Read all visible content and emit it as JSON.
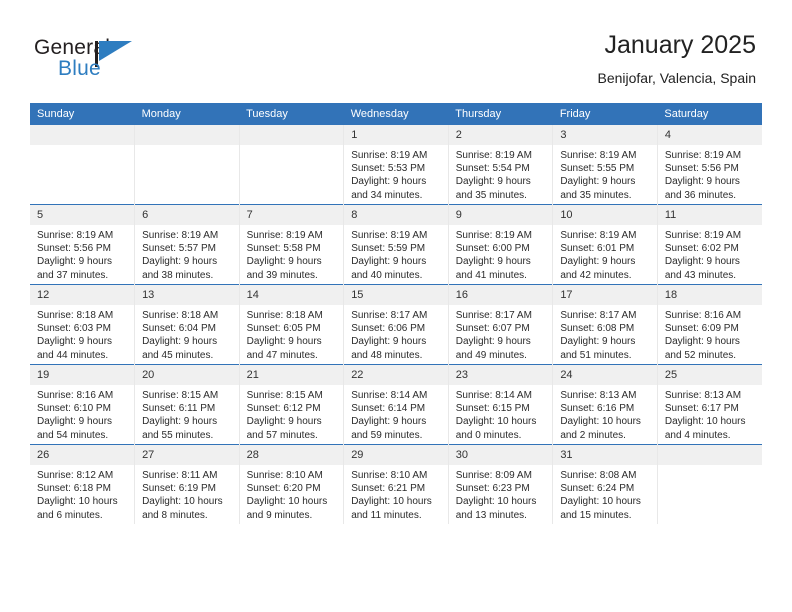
{
  "brand": {
    "name_top": "General",
    "name_bottom": "Blue",
    "color_dark": "#231f20",
    "color_blue": "#2e7dc0"
  },
  "header": {
    "title": "January 2025",
    "subtitle": "Benijofar, Valencia, Spain"
  },
  "theme": {
    "header_blue": "#3273b8",
    "daynum_gray": "#f0f0f0",
    "grid_line": "#e8e8e8"
  },
  "weekdays": [
    "Sunday",
    "Monday",
    "Tuesday",
    "Wednesday",
    "Thursday",
    "Friday",
    "Saturday"
  ],
  "labels": {
    "sunrise_prefix": "Sunrise:",
    "sunset_prefix": "Sunset:",
    "daylight_prefix": "Daylight:"
  },
  "weeks": [
    [
      {
        "day": "",
        "blank": true,
        "line1": "",
        "line2": "",
        "line3": "",
        "line4": ""
      },
      {
        "day": "",
        "blank": true,
        "line1": "",
        "line2": "",
        "line3": "",
        "line4": ""
      },
      {
        "day": "",
        "blank": true,
        "line1": "",
        "line2": "",
        "line3": "",
        "line4": ""
      },
      {
        "day": "1",
        "sunrise": "8:19 AM",
        "sunset": "5:53 PM",
        "daylight_hours": "9 hours",
        "daylight_minutes": "34 minutes",
        "line1": "Sunrise: 8:19 AM",
        "line2": "Sunset: 5:53 PM",
        "line3": "Daylight: 9 hours",
        "line4": "and 34 minutes."
      },
      {
        "day": "2",
        "sunrise": "8:19 AM",
        "sunset": "5:54 PM",
        "daylight_hours": "9 hours",
        "daylight_minutes": "35 minutes",
        "line1": "Sunrise: 8:19 AM",
        "line2": "Sunset: 5:54 PM",
        "line3": "Daylight: 9 hours",
        "line4": "and 35 minutes."
      },
      {
        "day": "3",
        "sunrise": "8:19 AM",
        "sunset": "5:55 PM",
        "daylight_hours": "9 hours",
        "daylight_minutes": "35 minutes",
        "line1": "Sunrise: 8:19 AM",
        "line2": "Sunset: 5:55 PM",
        "line3": "Daylight: 9 hours",
        "line4": "and 35 minutes."
      },
      {
        "day": "4",
        "sunrise": "8:19 AM",
        "sunset": "5:56 PM",
        "daylight_hours": "9 hours",
        "daylight_minutes": "36 minutes",
        "line1": "Sunrise: 8:19 AM",
        "line2": "Sunset: 5:56 PM",
        "line3": "Daylight: 9 hours",
        "line4": "and 36 minutes."
      }
    ],
    [
      {
        "day": "5",
        "sunrise": "8:19 AM",
        "sunset": "5:56 PM",
        "daylight_hours": "9 hours",
        "daylight_minutes": "37 minutes",
        "line1": "Sunrise: 8:19 AM",
        "line2": "Sunset: 5:56 PM",
        "line3": "Daylight: 9 hours",
        "line4": "and 37 minutes."
      },
      {
        "day": "6",
        "sunrise": "8:19 AM",
        "sunset": "5:57 PM",
        "daylight_hours": "9 hours",
        "daylight_minutes": "38 minutes",
        "line1": "Sunrise: 8:19 AM",
        "line2": "Sunset: 5:57 PM",
        "line3": "Daylight: 9 hours",
        "line4": "and 38 minutes."
      },
      {
        "day": "7",
        "sunrise": "8:19 AM",
        "sunset": "5:58 PM",
        "daylight_hours": "9 hours",
        "daylight_minutes": "39 minutes",
        "line1": "Sunrise: 8:19 AM",
        "line2": "Sunset: 5:58 PM",
        "line3": "Daylight: 9 hours",
        "line4": "and 39 minutes."
      },
      {
        "day": "8",
        "sunrise": "8:19 AM",
        "sunset": "5:59 PM",
        "daylight_hours": "9 hours",
        "daylight_minutes": "40 minutes",
        "line1": "Sunrise: 8:19 AM",
        "line2": "Sunset: 5:59 PM",
        "line3": "Daylight: 9 hours",
        "line4": "and 40 minutes."
      },
      {
        "day": "9",
        "sunrise": "8:19 AM",
        "sunset": "6:00 PM",
        "daylight_hours": "9 hours",
        "daylight_minutes": "41 minutes",
        "line1": "Sunrise: 8:19 AM",
        "line2": "Sunset: 6:00 PM",
        "line3": "Daylight: 9 hours",
        "line4": "and 41 minutes."
      },
      {
        "day": "10",
        "sunrise": "8:19 AM",
        "sunset": "6:01 PM",
        "daylight_hours": "9 hours",
        "daylight_minutes": "42 minutes",
        "line1": "Sunrise: 8:19 AM",
        "line2": "Sunset: 6:01 PM",
        "line3": "Daylight: 9 hours",
        "line4": "and 42 minutes."
      },
      {
        "day": "11",
        "sunrise": "8:19 AM",
        "sunset": "6:02 PM",
        "daylight_hours": "9 hours",
        "daylight_minutes": "43 minutes",
        "line1": "Sunrise: 8:19 AM",
        "line2": "Sunset: 6:02 PM",
        "line3": "Daylight: 9 hours",
        "line4": "and 43 minutes."
      }
    ],
    [
      {
        "day": "12",
        "sunrise": "8:18 AM",
        "sunset": "6:03 PM",
        "daylight_hours": "9 hours",
        "daylight_minutes": "44 minutes",
        "line1": "Sunrise: 8:18 AM",
        "line2": "Sunset: 6:03 PM",
        "line3": "Daylight: 9 hours",
        "line4": "and 44 minutes."
      },
      {
        "day": "13",
        "sunrise": "8:18 AM",
        "sunset": "6:04 PM",
        "daylight_hours": "9 hours",
        "daylight_minutes": "45 minutes",
        "line1": "Sunrise: 8:18 AM",
        "line2": "Sunset: 6:04 PM",
        "line3": "Daylight: 9 hours",
        "line4": "and 45 minutes."
      },
      {
        "day": "14",
        "sunrise": "8:18 AM",
        "sunset": "6:05 PM",
        "daylight_hours": "9 hours",
        "daylight_minutes": "47 minutes",
        "line1": "Sunrise: 8:18 AM",
        "line2": "Sunset: 6:05 PM",
        "line3": "Daylight: 9 hours",
        "line4": "and 47 minutes."
      },
      {
        "day": "15",
        "sunrise": "8:17 AM",
        "sunset": "6:06 PM",
        "daylight_hours": "9 hours",
        "daylight_minutes": "48 minutes",
        "line1": "Sunrise: 8:17 AM",
        "line2": "Sunset: 6:06 PM",
        "line3": "Daylight: 9 hours",
        "line4": "and 48 minutes."
      },
      {
        "day": "16",
        "sunrise": "8:17 AM",
        "sunset": "6:07 PM",
        "daylight_hours": "9 hours",
        "daylight_minutes": "49 minutes",
        "line1": "Sunrise: 8:17 AM",
        "line2": "Sunset: 6:07 PM",
        "line3": "Daylight: 9 hours",
        "line4": "and 49 minutes."
      },
      {
        "day": "17",
        "sunrise": "8:17 AM",
        "sunset": "6:08 PM",
        "daylight_hours": "9 hours",
        "daylight_minutes": "51 minutes",
        "line1": "Sunrise: 8:17 AM",
        "line2": "Sunset: 6:08 PM",
        "line3": "Daylight: 9 hours",
        "line4": "and 51 minutes."
      },
      {
        "day": "18",
        "sunrise": "8:16 AM",
        "sunset": "6:09 PM",
        "daylight_hours": "9 hours",
        "daylight_minutes": "52 minutes",
        "line1": "Sunrise: 8:16 AM",
        "line2": "Sunset: 6:09 PM",
        "line3": "Daylight: 9 hours",
        "line4": "and 52 minutes."
      }
    ],
    [
      {
        "day": "19",
        "sunrise": "8:16 AM",
        "sunset": "6:10 PM",
        "daylight_hours": "9 hours",
        "daylight_minutes": "54 minutes",
        "line1": "Sunrise: 8:16 AM",
        "line2": "Sunset: 6:10 PM",
        "line3": "Daylight: 9 hours",
        "line4": "and 54 minutes."
      },
      {
        "day": "20",
        "sunrise": "8:15 AM",
        "sunset": "6:11 PM",
        "daylight_hours": "9 hours",
        "daylight_minutes": "55 minutes",
        "line1": "Sunrise: 8:15 AM",
        "line2": "Sunset: 6:11 PM",
        "line3": "Daylight: 9 hours",
        "line4": "and 55 minutes."
      },
      {
        "day": "21",
        "sunrise": "8:15 AM",
        "sunset": "6:12 PM",
        "daylight_hours": "9 hours",
        "daylight_minutes": "57 minutes",
        "line1": "Sunrise: 8:15 AM",
        "line2": "Sunset: 6:12 PM",
        "line3": "Daylight: 9 hours",
        "line4": "and 57 minutes."
      },
      {
        "day": "22",
        "sunrise": "8:14 AM",
        "sunset": "6:14 PM",
        "daylight_hours": "9 hours",
        "daylight_minutes": "59 minutes",
        "line1": "Sunrise: 8:14 AM",
        "line2": "Sunset: 6:14 PM",
        "line3": "Daylight: 9 hours",
        "line4": "and 59 minutes."
      },
      {
        "day": "23",
        "sunrise": "8:14 AM",
        "sunset": "6:15 PM",
        "daylight_hours": "10 hours",
        "daylight_minutes": "0 minutes",
        "line1": "Sunrise: 8:14 AM",
        "line2": "Sunset: 6:15 PM",
        "line3": "Daylight: 10 hours",
        "line4": "and 0 minutes."
      },
      {
        "day": "24",
        "sunrise": "8:13 AM",
        "sunset": "6:16 PM",
        "daylight_hours": "10 hours",
        "daylight_minutes": "2 minutes",
        "line1": "Sunrise: 8:13 AM",
        "line2": "Sunset: 6:16 PM",
        "line3": "Daylight: 10 hours",
        "line4": "and 2 minutes."
      },
      {
        "day": "25",
        "sunrise": "8:13 AM",
        "sunset": "6:17 PM",
        "daylight_hours": "10 hours",
        "daylight_minutes": "4 minutes",
        "line1": "Sunrise: 8:13 AM",
        "line2": "Sunset: 6:17 PM",
        "line3": "Daylight: 10 hours",
        "line4": "and 4 minutes."
      }
    ],
    [
      {
        "day": "26",
        "sunrise": "8:12 AM",
        "sunset": "6:18 PM",
        "daylight_hours": "10 hours",
        "daylight_minutes": "6 minutes",
        "line1": "Sunrise: 8:12 AM",
        "line2": "Sunset: 6:18 PM",
        "line3": "Daylight: 10 hours",
        "line4": "and 6 minutes."
      },
      {
        "day": "27",
        "sunrise": "8:11 AM",
        "sunset": "6:19 PM",
        "daylight_hours": "10 hours",
        "daylight_minutes": "8 minutes",
        "line1": "Sunrise: 8:11 AM",
        "line2": "Sunset: 6:19 PM",
        "line3": "Daylight: 10 hours",
        "line4": "and 8 minutes."
      },
      {
        "day": "28",
        "sunrise": "8:10 AM",
        "sunset": "6:20 PM",
        "daylight_hours": "10 hours",
        "daylight_minutes": "9 minutes",
        "line1": "Sunrise: 8:10 AM",
        "line2": "Sunset: 6:20 PM",
        "line3": "Daylight: 10 hours",
        "line4": "and 9 minutes."
      },
      {
        "day": "29",
        "sunrise": "8:10 AM",
        "sunset": "6:21 PM",
        "daylight_hours": "10 hours",
        "daylight_minutes": "11 minutes",
        "line1": "Sunrise: 8:10 AM",
        "line2": "Sunset: 6:21 PM",
        "line3": "Daylight: 10 hours",
        "line4": "and 11 minutes."
      },
      {
        "day": "30",
        "sunrise": "8:09 AM",
        "sunset": "6:23 PM",
        "daylight_hours": "10 hours",
        "daylight_minutes": "13 minutes",
        "line1": "Sunrise: 8:09 AM",
        "line2": "Sunset: 6:23 PM",
        "line3": "Daylight: 10 hours",
        "line4": "and 13 minutes."
      },
      {
        "day": "31",
        "sunrise": "8:08 AM",
        "sunset": "6:24 PM",
        "daylight_hours": "10 hours",
        "daylight_minutes": "15 minutes",
        "line1": "Sunrise: 8:08 AM",
        "line2": "Sunset: 6:24 PM",
        "line3": "Daylight: 10 hours",
        "line4": "and 15 minutes."
      },
      {
        "day": "",
        "blank": true,
        "line1": "",
        "line2": "",
        "line3": "",
        "line4": ""
      }
    ]
  ]
}
